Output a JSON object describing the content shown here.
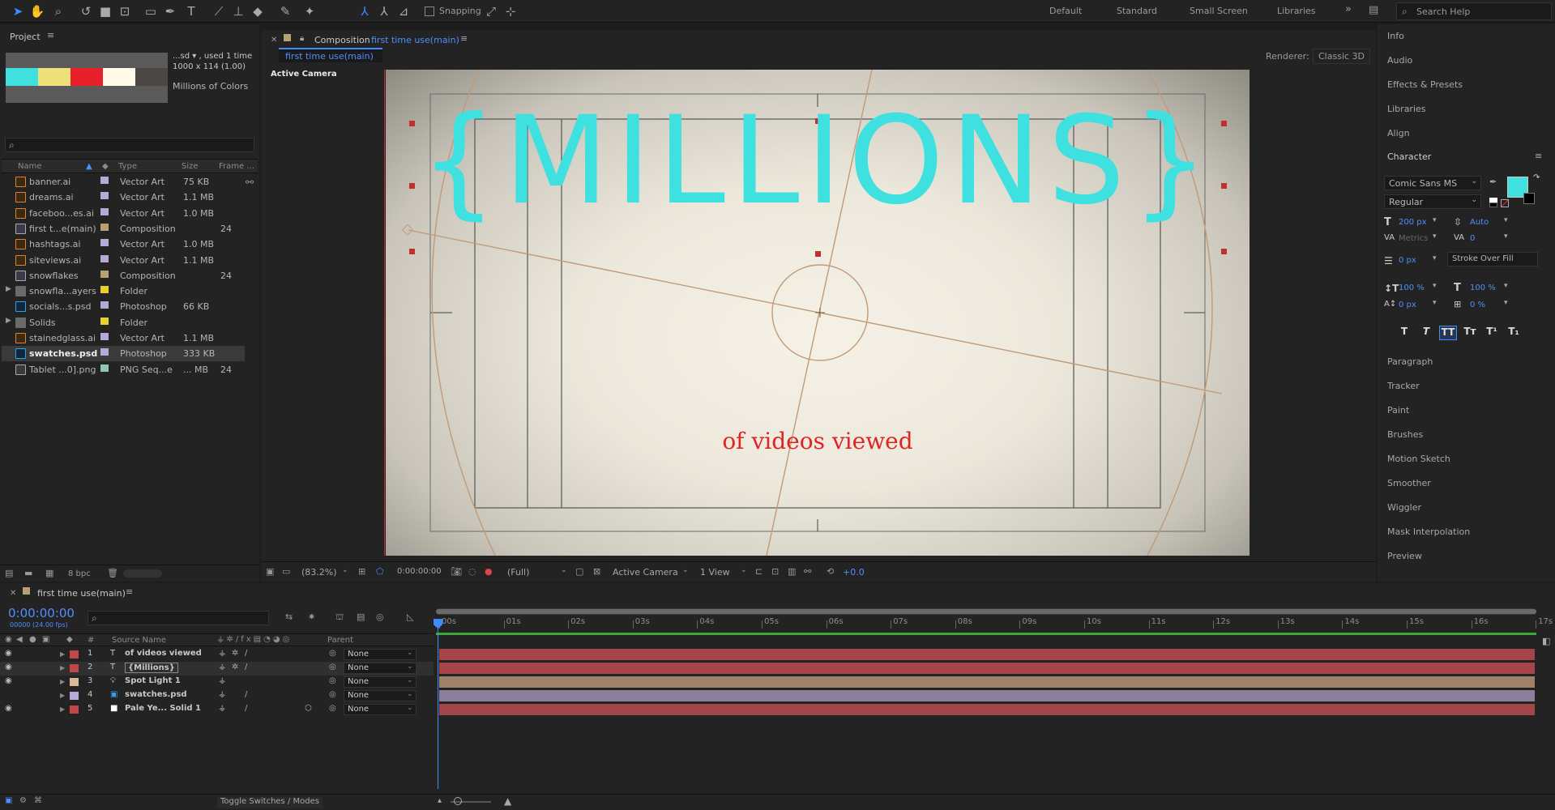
{
  "toolbar": {
    "snapping_label": "Snapping",
    "workspaces": [
      "Default",
      "Standard",
      "Small Screen",
      "Libraries"
    ],
    "search_placeholder": "Search Help"
  },
  "project": {
    "title": "Project",
    "preview": {
      "name": "...sd ▾ , used 1 time",
      "dims": "1000 x 114 (1.00)",
      "desc": "Millions of Colors",
      "swatches": [
        "#40e0e0",
        "#f0e07a",
        "#e8202a",
        "#fffbe8",
        "#4a4744"
      ]
    },
    "columns": [
      "Name",
      "Type",
      "Size",
      "Frame ..."
    ],
    "items": [
      {
        "name": "banner.ai",
        "type": "Vector Art",
        "size": "75 KB",
        "frame": "",
        "icon": "ai",
        "label": "#b8a8d8"
      },
      {
        "name": "dreams.ai",
        "type": "Vector Art",
        "size": "1.1 MB",
        "frame": "",
        "icon": "ai",
        "label": "#b8a8d8"
      },
      {
        "name": "faceboo...es.ai",
        "type": "Vector Art",
        "size": "1.0 MB",
        "frame": "",
        "icon": "ai",
        "label": "#b8a8d8"
      },
      {
        "name": "first t...e(main)",
        "type": "Composition",
        "size": "",
        "frame": "24",
        "icon": "comp",
        "label": "#b8a070"
      },
      {
        "name": "hashtags.ai",
        "type": "Vector Art",
        "size": "1.0 MB",
        "frame": "",
        "icon": "ai",
        "label": "#b8a8d8"
      },
      {
        "name": "siteviews.ai",
        "type": "Vector Art",
        "size": "1.1 MB",
        "frame": "",
        "icon": "ai",
        "label": "#b8a8d8"
      },
      {
        "name": "snowflakes",
        "type": "Composition",
        "size": "",
        "frame": "24",
        "icon": "comp",
        "label": "#b8a070"
      },
      {
        "name": "snowfla...ayers",
        "type": "Folder",
        "size": "",
        "frame": "",
        "icon": "folder",
        "label": "#e8d030"
      },
      {
        "name": "socials...s.psd",
        "type": "Photoshop",
        "size": "66 KB",
        "frame": "",
        "icon": "psd",
        "label": "#b8a8d8"
      },
      {
        "name": "Solids",
        "type": "Folder",
        "size": "",
        "frame": "",
        "icon": "folder",
        "label": "#e8d030"
      },
      {
        "name": "stainedglass.ai",
        "type": "Vector Art",
        "size": "1.1 MB",
        "frame": "",
        "icon": "ai",
        "label": "#b8a8d8"
      },
      {
        "name": "swatches.psd",
        "type": "Photoshop",
        "size": "333 KB",
        "frame": "",
        "icon": "psd",
        "label": "#b8a8d8"
      },
      {
        "name": "Tablet ...0].png",
        "type": "PNG Seq...e",
        "size": "... MB",
        "frame": "24",
        "icon": "png",
        "label": "#90c8b8"
      }
    ],
    "bpc": "8 bpc"
  },
  "composition": {
    "panel_title_prefix": "Composition",
    "panel_title_name": "first time use(main)",
    "tab": "first time use(main)",
    "renderer_label": "Renderer:",
    "renderer_value": "Classic 3D",
    "view_label": "Active Camera",
    "big_text": "{MILLIONS}",
    "sub_text": "of videos viewed",
    "zoom": "(83.2%)",
    "timecode": "0:00:00:00",
    "resolution": "(Full)",
    "camera": "Active Camera",
    "views": "1 View",
    "exposure": "+0.0"
  },
  "right_panels": {
    "top": [
      "Info",
      "Audio",
      "Effects & Presets",
      "Libraries",
      "Align"
    ],
    "character": {
      "title": "Character",
      "font": "Comic Sans MS",
      "style": "Regular",
      "size": "200 px",
      "leading": "Auto",
      "kerning": "Metrics",
      "tracking": "0",
      "stroke": "0 px",
      "stroke_mode": "Stroke Over Fill",
      "vscale": "100 %",
      "hscale": "100 %",
      "baseline": "0 px",
      "tsume": "0 %",
      "fill_color": "#3ee0e0",
      "styles": [
        "T",
        "T",
        "TT",
        "Tт",
        "T¹",
        "T₁"
      ]
    },
    "bottom": [
      "Paragraph",
      "Tracker",
      "Paint",
      "Brushes",
      "Motion Sketch",
      "Smoother",
      "Wiggler",
      "Mask Interpolation",
      "Preview"
    ]
  },
  "timeline": {
    "tab": "first time use(main)",
    "timecode": "0:00:00:00",
    "fps": "00000 (24.00 fps)",
    "col_source": "Source Name",
    "col_num": "#",
    "col_parent": "Parent",
    "layers": [
      {
        "num": "1",
        "name": "of videos viewed",
        "type": "T",
        "parent": "None",
        "label": "#c04848",
        "bar": "#a34549"
      },
      {
        "num": "2",
        "name": "{Millions}",
        "type": "T",
        "parent": "None",
        "label": "#c04848",
        "bar": "#a34549"
      },
      {
        "num": "3",
        "name": "Spot Light 1",
        "type": "light",
        "parent": "None",
        "label": "#d8b898",
        "bar": "#a08068"
      },
      {
        "num": "4",
        "name": "swatches.psd",
        "type": "psd",
        "parent": "None",
        "label": "#b8a8d8",
        "bar": "#8a7f9a"
      },
      {
        "num": "5",
        "name": "Pale Ye... Solid 1",
        "type": "solid",
        "parent": "None",
        "label": "#c04848",
        "bar": "#a34549"
      }
    ],
    "ruler": [
      "00s",
      "01s",
      "02s",
      "03s",
      "04s",
      "05s",
      "06s",
      "07s",
      "08s",
      "09s",
      "10s",
      "11s",
      "12s",
      "13s",
      "14s",
      "15s",
      "16s",
      "17s"
    ],
    "toggle_label": "Toggle Switches / Modes"
  }
}
